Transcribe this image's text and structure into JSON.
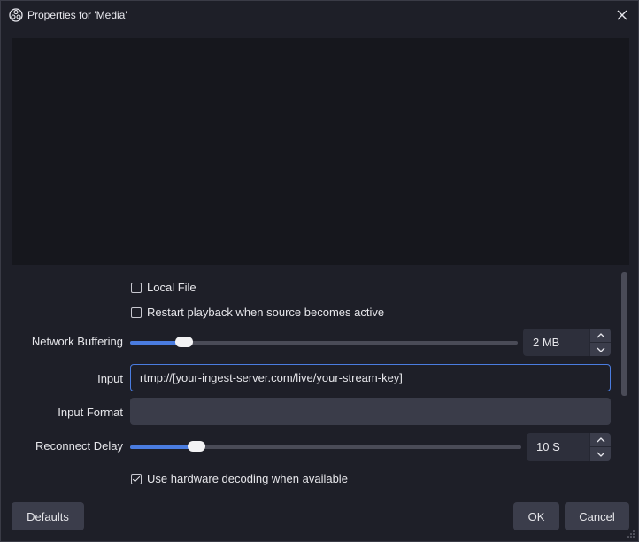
{
  "window": {
    "title": "Properties for 'Media'"
  },
  "options": {
    "local_file": {
      "label": "Local File",
      "checked": false
    },
    "restart_playback": {
      "label": "Restart playback when source becomes active",
      "checked": false
    },
    "hardware_decoding": {
      "label": "Use hardware decoding when available",
      "checked": true
    }
  },
  "network_buffering": {
    "label": "Network Buffering",
    "value": "2 MB",
    "fraction": 0.14
  },
  "input": {
    "label": "Input",
    "value": "rtmp://[your-ingest-server.com/live/your-stream-key]"
  },
  "input_format": {
    "label": "Input Format",
    "value": ""
  },
  "reconnect_delay": {
    "label": "Reconnect Delay",
    "value": "10 S",
    "fraction": 0.17
  },
  "buttons": {
    "defaults": "Defaults",
    "ok": "OK",
    "cancel": "Cancel"
  },
  "colors": {
    "accent": "#4a7ce0",
    "background": "#1e1f28",
    "preview": "#16171d"
  }
}
